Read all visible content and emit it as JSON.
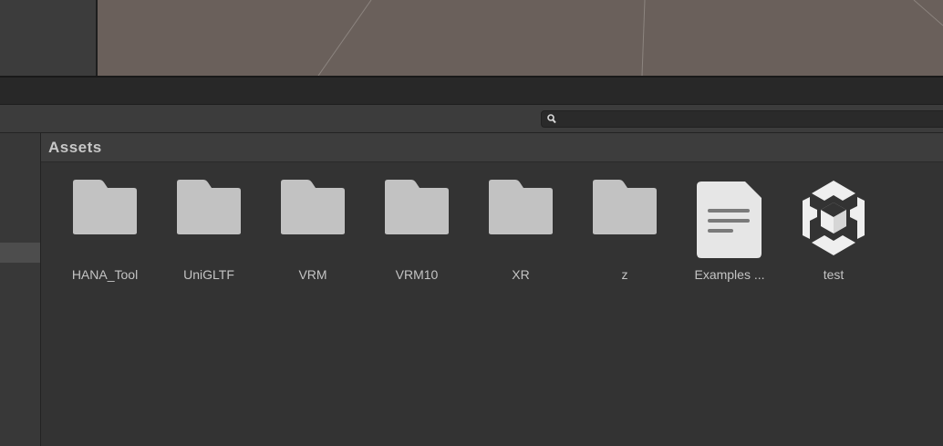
{
  "project": {
    "breadcrumb": "Assets",
    "search": {
      "value": "",
      "placeholder": ""
    },
    "assets": [
      {
        "label": "HANA_Tool",
        "icon": "folder-icon",
        "kind": "folder"
      },
      {
        "label": "UniGLTF",
        "icon": "folder-icon",
        "kind": "folder"
      },
      {
        "label": "VRM",
        "icon": "folder-icon",
        "kind": "folder"
      },
      {
        "label": "VRM10",
        "icon": "folder-icon",
        "kind": "folder"
      },
      {
        "label": "XR",
        "icon": "folder-icon",
        "kind": "folder"
      },
      {
        "label": "z",
        "icon": "folder-icon",
        "kind": "folder"
      },
      {
        "label": "Examples ...",
        "icon": "text-file-icon",
        "kind": "file"
      },
      {
        "label": "test",
        "icon": "unity-scene-icon",
        "kind": "scene"
      }
    ]
  },
  "colors": {
    "scene_background": "#6a605b",
    "panel_background": "#333333",
    "folder_icon": "#c2c2c2",
    "file_icon": "#e6e6e6"
  }
}
